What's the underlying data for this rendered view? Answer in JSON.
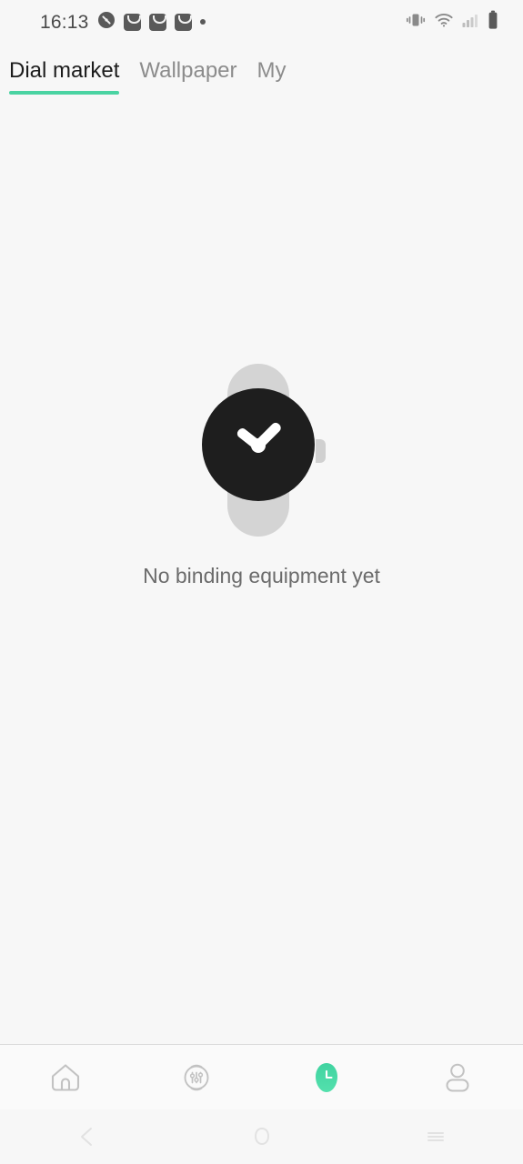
{
  "theme": {
    "background": "#f7f7f7",
    "accent_green": "#4ad3a2",
    "text_primary": "#1c1c1c",
    "text_secondary": "#8c8c8c",
    "watch_band": "#d4d4d4",
    "watch_face": "#1e1e1e"
  },
  "status_bar": {
    "time": "16:13",
    "left_icons": [
      "clock-badge-icon",
      "mail-icon",
      "mail-icon",
      "mail-icon",
      "dot-icon"
    ],
    "right_icons": [
      "vibrate-icon",
      "wifi-icon",
      "cellular-signal-icon",
      "battery-icon"
    ]
  },
  "tabs": [
    {
      "label": "Dial market",
      "active": true
    },
    {
      "label": "Wallpaper",
      "active": false
    },
    {
      "label": "My",
      "active": false
    }
  ],
  "empty_state": {
    "illustration": "smartwatch-illustration",
    "message": "No binding equipment yet"
  },
  "bottom_nav": [
    {
      "name": "home",
      "icon": "home-icon",
      "active": false
    },
    {
      "name": "device",
      "icon": "watch-settings-icon",
      "active": false
    },
    {
      "name": "dial",
      "icon": "watch-face-blob-icon",
      "active": true
    },
    {
      "name": "profile",
      "icon": "person-icon",
      "active": false
    }
  ],
  "system_nav": [
    {
      "name": "back",
      "icon": "back-chevron-icon"
    },
    {
      "name": "home",
      "icon": "home-circle-icon"
    },
    {
      "name": "recents",
      "icon": "recents-lines-icon"
    }
  ]
}
